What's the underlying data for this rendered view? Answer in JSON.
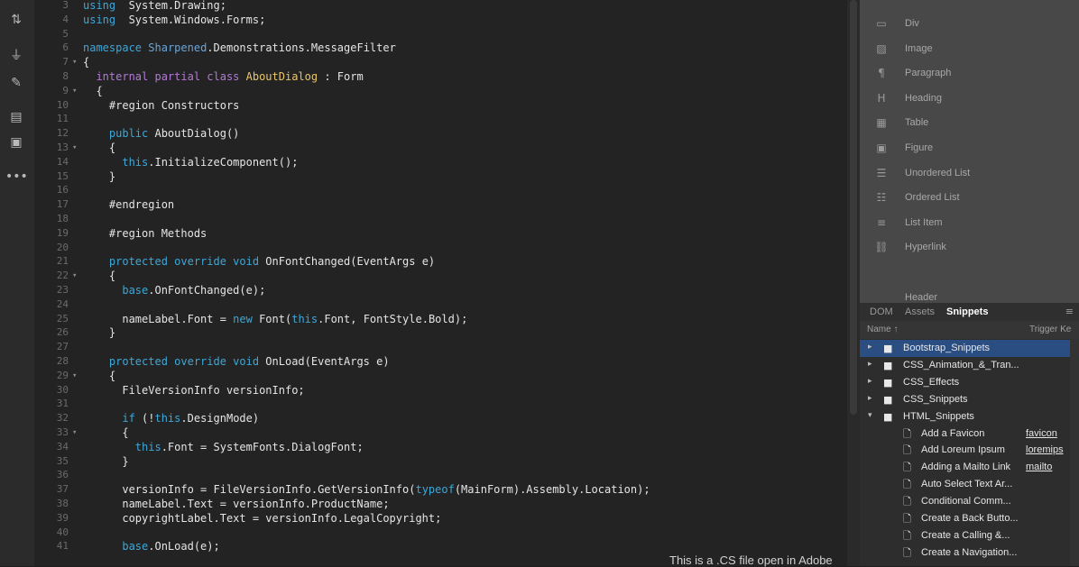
{
  "toolbar": {
    "tools": [
      {
        "icon": "tag-icon",
        "glyph": "⇅"
      },
      {
        "icon": "filter-icon",
        "glyph": "⏚"
      },
      {
        "icon": "brush-icon",
        "glyph": "✎"
      },
      {
        "icon": "comment-icon",
        "glyph": "▤"
      },
      {
        "icon": "snippet-icon",
        "glyph": "▣"
      },
      {
        "icon": "more-icon",
        "glyph": "•••"
      }
    ]
  },
  "editor": {
    "lines": [
      {
        "n": "3",
        "fold": "",
        "segs": [
          [
            "kw",
            "using"
          ],
          [
            "",
            "  System.Drawing;"
          ]
        ]
      },
      {
        "n": "4",
        "fold": "",
        "segs": [
          [
            "kw",
            "using"
          ],
          [
            "",
            "  System.Windows.Forms;"
          ]
        ]
      },
      {
        "n": "5",
        "fold": "",
        "segs": []
      },
      {
        "n": "6",
        "fold": "",
        "segs": [
          [
            "kw",
            "namespace"
          ],
          [
            "",
            " "
          ],
          [
            "ns",
            "Sharpened"
          ],
          [
            "",
            ".Demonstrations.MessageFilter"
          ]
        ]
      },
      {
        "n": "7",
        "fold": "▾",
        "segs": [
          [
            "",
            "{"
          ]
        ]
      },
      {
        "n": "8",
        "fold": "",
        "segs": [
          [
            "kw2",
            "  internal partial class "
          ],
          [
            "ty",
            "AboutDialog"
          ],
          [
            "",
            " : Form"
          ]
        ]
      },
      {
        "n": "9",
        "fold": "▾",
        "segs": [
          [
            "",
            "  {"
          ]
        ]
      },
      {
        "n": "10",
        "fold": "",
        "segs": [
          [
            "",
            "    #region Constructors"
          ]
        ]
      },
      {
        "n": "11",
        "fold": "",
        "segs": []
      },
      {
        "n": "12",
        "fold": "",
        "segs": [
          [
            "kw",
            "    public"
          ],
          [
            "",
            " AboutDialog()"
          ]
        ]
      },
      {
        "n": "13",
        "fold": "▾",
        "segs": [
          [
            "",
            "    {"
          ]
        ]
      },
      {
        "n": "14",
        "fold": "",
        "segs": [
          [
            "kw",
            "      this"
          ],
          [
            "",
            ".InitializeComponent();"
          ]
        ]
      },
      {
        "n": "15",
        "fold": "",
        "segs": [
          [
            "",
            "    }"
          ]
        ]
      },
      {
        "n": "16",
        "fold": "",
        "segs": []
      },
      {
        "n": "17",
        "fold": "",
        "segs": [
          [
            "",
            "    #endregion"
          ]
        ]
      },
      {
        "n": "18",
        "fold": "",
        "segs": []
      },
      {
        "n": "19",
        "fold": "",
        "segs": [
          [
            "",
            "    #region Methods"
          ]
        ]
      },
      {
        "n": "20",
        "fold": "",
        "segs": []
      },
      {
        "n": "21",
        "fold": "",
        "segs": [
          [
            "kw",
            "    protected override void"
          ],
          [
            "",
            " OnFontChanged(EventArgs e)"
          ]
        ]
      },
      {
        "n": "22",
        "fold": "▾",
        "segs": [
          [
            "",
            "    {"
          ]
        ]
      },
      {
        "n": "23",
        "fold": "",
        "segs": [
          [
            "kw",
            "      base"
          ],
          [
            "",
            ".OnFontChanged(e);"
          ]
        ]
      },
      {
        "n": "24",
        "fold": "",
        "segs": []
      },
      {
        "n": "25",
        "fold": "",
        "segs": [
          [
            "",
            "      nameLabel.Font = "
          ],
          [
            "kw",
            "new"
          ],
          [
            "",
            " Font("
          ],
          [
            "kw",
            "this"
          ],
          [
            "",
            ".Font, FontStyle.Bold);"
          ]
        ]
      },
      {
        "n": "26",
        "fold": "",
        "segs": [
          [
            "",
            "    }"
          ]
        ]
      },
      {
        "n": "27",
        "fold": "",
        "segs": []
      },
      {
        "n": "28",
        "fold": "",
        "segs": [
          [
            "kw",
            "    protected override void"
          ],
          [
            "",
            " OnLoad(EventArgs e)"
          ]
        ]
      },
      {
        "n": "29",
        "fold": "▾",
        "segs": [
          [
            "",
            "    {"
          ]
        ]
      },
      {
        "n": "30",
        "fold": "",
        "segs": [
          [
            "",
            "      FileVersionInfo versionInfo;"
          ]
        ]
      },
      {
        "n": "31",
        "fold": "",
        "segs": []
      },
      {
        "n": "32",
        "fold": "",
        "segs": [
          [
            "kw",
            "      if"
          ],
          [
            "",
            " (!"
          ],
          [
            "kw",
            "this"
          ],
          [
            "",
            ".DesignMode)"
          ]
        ]
      },
      {
        "n": "33",
        "fold": "▾",
        "segs": [
          [
            "",
            "      {"
          ]
        ]
      },
      {
        "n": "34",
        "fold": "",
        "segs": [
          [
            "kw",
            "        this"
          ],
          [
            "",
            ".Font = SystemFonts.DialogFont;"
          ]
        ]
      },
      {
        "n": "35",
        "fold": "",
        "segs": [
          [
            "",
            "      }"
          ]
        ]
      },
      {
        "n": "36",
        "fold": "",
        "segs": []
      },
      {
        "n": "37",
        "fold": "",
        "segs": [
          [
            "",
            "      versionInfo = FileVersionInfo.GetVersionInfo("
          ],
          [
            "kw",
            "typeof"
          ],
          [
            "",
            "(MainForm).Assembly.Location);"
          ]
        ]
      },
      {
        "n": "38",
        "fold": "",
        "segs": [
          [
            "",
            "      nameLabel.Text = versionInfo.ProductName;"
          ]
        ]
      },
      {
        "n": "39",
        "fold": "",
        "segs": [
          [
            "",
            "      copyrightLabel.Text = versionInfo.LegalCopyright;"
          ]
        ]
      },
      {
        "n": "40",
        "fold": "",
        "segs": []
      },
      {
        "n": "41",
        "fold": "",
        "segs": [
          [
            "kw",
            "      base"
          ],
          [
            "",
            ".OnLoad(e);"
          ]
        ]
      }
    ]
  },
  "caption": "This is a .CS file open in Adobe",
  "insert_panel": {
    "items": [
      {
        "icon": "div-icon",
        "glyph": "▭",
        "label": "Div"
      },
      {
        "icon": "image-icon",
        "glyph": "▨",
        "label": "Image"
      },
      {
        "icon": "paragraph-icon",
        "glyph": "¶",
        "label": "Paragraph"
      },
      {
        "icon": "heading-icon",
        "glyph": "H",
        "label": "Heading"
      },
      {
        "icon": "table-icon",
        "glyph": "▦",
        "label": "Table"
      },
      {
        "icon": "figure-icon",
        "glyph": "▣",
        "label": "Figure"
      },
      {
        "icon": "unordered-list-icon",
        "glyph": "☰",
        "label": "Unordered List"
      },
      {
        "icon": "ordered-list-icon",
        "glyph": "☷",
        "label": "Ordered List"
      },
      {
        "icon": "list-item-icon",
        "glyph": "≡",
        "label": "List Item"
      },
      {
        "icon": "hyperlink-icon",
        "glyph": "⛓",
        "label": "Hyperlink"
      }
    ],
    "partial_label": "Header"
  },
  "panel_tabs": [
    {
      "label": "DOM",
      "active": false
    },
    {
      "label": "Assets",
      "active": false
    },
    {
      "label": "Snippets",
      "active": true
    }
  ],
  "columns": {
    "name": "Name ↑",
    "trigger": "Trigger Ke"
  },
  "snippets": [
    {
      "type": "folder",
      "open": false,
      "label": "Bootstrap_Snippets",
      "trigger": "",
      "selected": true
    },
    {
      "type": "folder",
      "open": false,
      "label": "CSS_Animation_&_Tran...",
      "trigger": "",
      "selected": false
    },
    {
      "type": "folder",
      "open": false,
      "label": "CSS_Effects",
      "trigger": "",
      "selected": false
    },
    {
      "type": "folder",
      "open": false,
      "label": "CSS_Snippets",
      "trigger": "",
      "selected": false
    },
    {
      "type": "folder",
      "open": true,
      "label": "HTML_Snippets",
      "trigger": "",
      "selected": false
    },
    {
      "type": "file",
      "label": "Add a Favicon",
      "trigger": "favicon",
      "selected": false
    },
    {
      "type": "file",
      "label": "Add Loreum Ipsum",
      "trigger": "loremips",
      "selected": false
    },
    {
      "type": "file",
      "label": "Adding a Mailto Link",
      "trigger": "mailto",
      "selected": false
    },
    {
      "type": "file",
      "label": "Auto Select Text Ar...",
      "trigger": "",
      "selected": false
    },
    {
      "type": "file",
      "label": "Conditional Comm...",
      "trigger": "",
      "selected": false
    },
    {
      "type": "file",
      "label": "Create a Back Butto...",
      "trigger": "",
      "selected": false
    },
    {
      "type": "file",
      "label": "Create a Calling &...",
      "trigger": "",
      "selected": false
    },
    {
      "type": "file",
      "label": "Create a Navigation...",
      "trigger": "",
      "selected": false
    }
  ],
  "colors": {
    "editor_bg": "#232323",
    "keyword": "#3ea7d8",
    "modifier": "#b27ad6",
    "type_name": "#e8c66a",
    "selected_row": "#2b4e82"
  }
}
